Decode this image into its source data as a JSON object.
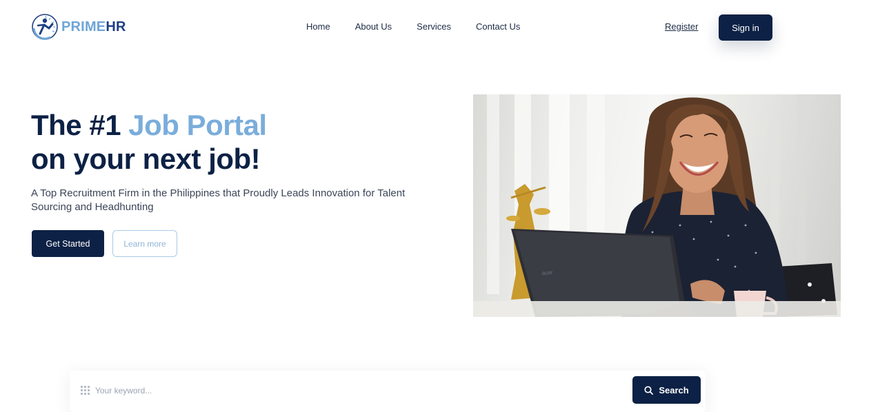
{
  "header": {
    "logo": {
      "prime": "PRIME",
      "hr": "HR",
      "icon": "logo-globe-runner-icon"
    },
    "nav": [
      "Home",
      "About Us",
      "Services",
      "Contact Us"
    ],
    "register_label": "Register",
    "signin_label": "Sign in"
  },
  "hero": {
    "title_line1_pre": "The #1 ",
    "title_line1_accent": "Job Portal",
    "title_line2": "on your next job!",
    "subtitle": "A Top Recruitment Firm in the Philippines that Proudly Leads Innovation for Talent Sourcing and Headhunting",
    "primary_button": "Get Started",
    "secondary_button": "Learn more"
  },
  "search": {
    "placeholder": "Your keyword...",
    "button_label": "Search",
    "icon": "search-icon",
    "left_icon": "grid-icon"
  },
  "colors": {
    "navy": "#0c2145",
    "accent_blue": "#7aaddb",
    "outline_blue": "#a9c9e8"
  }
}
